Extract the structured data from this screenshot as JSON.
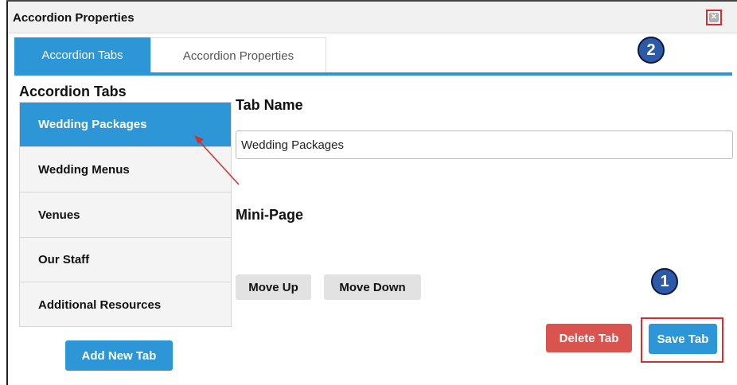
{
  "window": {
    "title": "Accordion Properties"
  },
  "tabs": {
    "active": "Accordion Tabs",
    "inactive": "Accordion Properties"
  },
  "annotations": {
    "badge_top": "2",
    "badge_bottom": "1"
  },
  "left_panel": {
    "heading": "Accordion Tabs",
    "items": [
      {
        "label": "Wedding Packages",
        "selected": true
      },
      {
        "label": "Wedding Menus"
      },
      {
        "label": "Venues"
      },
      {
        "label": "Our Staff"
      },
      {
        "label": "Additional Resources"
      }
    ],
    "add_button": "Add New Tab"
  },
  "form": {
    "tab_name_label": "Tab Name",
    "tab_name_value": "Wedding Packages",
    "mini_page_label": "Mini-Page",
    "move_up": "Move Up",
    "move_down": "Move Down",
    "delete_tab": "Delete Tab",
    "save_tab": "Save Tab"
  },
  "colors": {
    "accent": "#2c96d6",
    "danger": "#d9534f",
    "highlight_box": "#d62e2e",
    "badge": "#2d5aa8"
  },
  "icons": {
    "close": "close-icon"
  }
}
